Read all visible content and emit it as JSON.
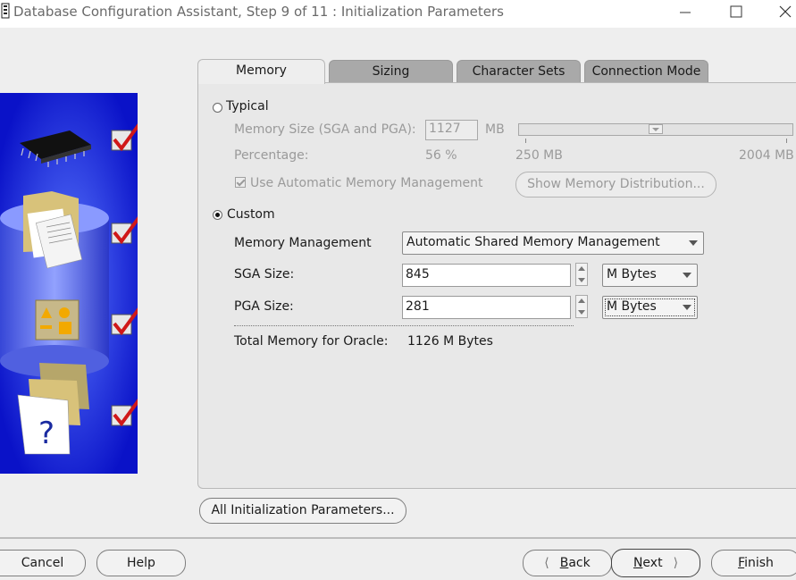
{
  "window": {
    "title": "Database Configuration Assistant, Step 9 of 11 : Initialization Parameters"
  },
  "tabs": [
    {
      "label": "Memory",
      "active": true
    },
    {
      "label": "Sizing",
      "active": false
    },
    {
      "label": "Character Sets",
      "active": false
    },
    {
      "label": "Connection Mode",
      "active": false
    }
  ],
  "memory": {
    "typical": {
      "label": "Typical",
      "selected": false,
      "memory_size_label": "Memory Size (SGA and PGA):",
      "memory_size_value": "1127",
      "memory_size_unit": "MB",
      "percentage_label": "Percentage:",
      "percentage_value": "56 %",
      "slider_min": "250 MB",
      "slider_max": "2004 MB",
      "slider_level": 0.5,
      "auto_mem_label": "Use Automatic Memory Management",
      "auto_mem_checked": true,
      "show_dist_label": "Show Memory Distribution..."
    },
    "custom": {
      "label": "Custom",
      "selected": true,
      "mgmt_label": "Memory Management",
      "mgmt_value": "Automatic Shared Memory Management",
      "sga_label": "SGA Size:",
      "sga_value": "845",
      "sga_unit": "M Bytes",
      "pga_label": "PGA Size:",
      "pga_value": "281",
      "pga_unit": "M Bytes",
      "total_label": "Total Memory for Oracle:",
      "total_value": "1126 M Bytes"
    }
  },
  "buttons": {
    "all_params": "All Initialization Parameters...",
    "cancel": "Cancel",
    "help": "Help",
    "back_prefix": "",
    "back_underlined": "B",
    "back_rest": "ack",
    "next_underlined": "N",
    "next_rest": "ext",
    "finish_underlined": "F",
    "finish_rest": "inish"
  },
  "icons": {
    "back": "chevron-left-icon",
    "next": "chevron-right-icon",
    "close": "close-icon",
    "minimize": "minimize-icon",
    "maximize": "maximize-icon"
  },
  "colors": {
    "side_panel": "#0a12c8",
    "check": "#d01818"
  }
}
